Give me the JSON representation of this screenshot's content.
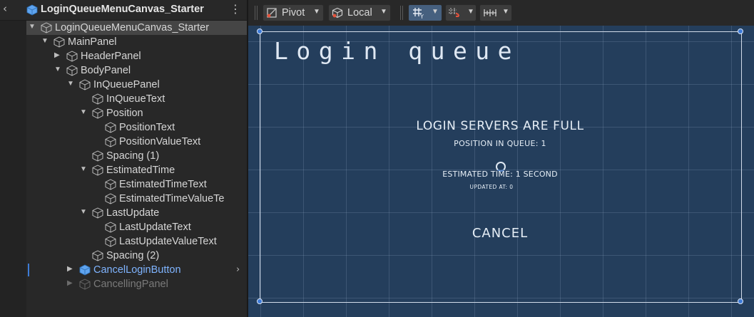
{
  "hierarchy": {
    "header_title": "LoginQueueMenuCanvas_Starter",
    "rows": [
      {
        "label": "LoginQueueMenuCanvas_Starter",
        "expanded": true
      },
      {
        "label": "MainPanel",
        "expanded": true
      },
      {
        "label": "HeaderPanel",
        "expanded": false
      },
      {
        "label": "BodyPanel",
        "expanded": true
      },
      {
        "label": "InQueuePanel",
        "expanded": true
      },
      {
        "label": "InQueueText"
      },
      {
        "label": "Position",
        "expanded": true
      },
      {
        "label": "PositionText"
      },
      {
        "label": "PositionValueText"
      },
      {
        "label": "Spacing (1)"
      },
      {
        "label": "EstimatedTime",
        "expanded": true
      },
      {
        "label": "EstimatedTimeText"
      },
      {
        "label": "EstimatedTimeValueTe"
      },
      {
        "label": "LastUpdate",
        "expanded": true
      },
      {
        "label": "LastUpdateText"
      },
      {
        "label": "LastUpdateValueText"
      },
      {
        "label": "Spacing (2)"
      },
      {
        "label": "CancelLoginButton",
        "expanded": false,
        "state": "selected-blue"
      },
      {
        "label": "CancellingPanel",
        "expanded": false,
        "state": "inactive"
      }
    ]
  },
  "toolbar": {
    "pivot_label": "Pivot",
    "local_label": "Local",
    "grid_snap_icon": "grid-snap-icon",
    "increment_snap_icon": "snap-increment-icon",
    "ruler_icon": "ruler-icon"
  },
  "scene": {
    "title": "Login queue",
    "servers_full": "LOGIN SERVERS ARE FULL",
    "position_text": "POSITION IN QUEUE:",
    "position_value": "1",
    "estimated_text": "ESTIMATED TIME:",
    "estimated_value": "1 SECOND",
    "updated_text": "UPDATED AT:",
    "updated_value": "0",
    "cancel_label": "CANCEL"
  },
  "colors": {
    "canvas_bg": "#243e5c",
    "selection_blue": "#7fb4ff",
    "handle_blue": "#3e7bd8"
  }
}
